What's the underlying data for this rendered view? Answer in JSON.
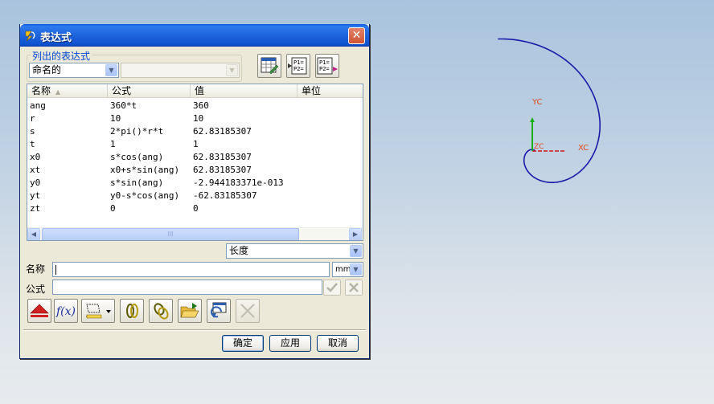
{
  "dialog": {
    "title": "表达式",
    "close_glyph": "✕",
    "listed_group_label": "列出的表达式",
    "filter_combo_value": "命名的",
    "secondary_combo_value": "",
    "tool_icons": [
      "spreadsheet-edit-icon",
      "import-expressions-icon",
      "export-expressions-icon"
    ],
    "columns": [
      "名称",
      "公式",
      "值",
      "单位"
    ],
    "rows": [
      {
        "name": "ang",
        "formula": "360*t",
        "value": "360",
        "unit": ""
      },
      {
        "name": "r",
        "formula": "10",
        "value": "10",
        "unit": ""
      },
      {
        "name": "s",
        "formula": "2*pi()*r*t",
        "value": "62.83185307",
        "unit": ""
      },
      {
        "name": "t",
        "formula": "1",
        "value": "1",
        "unit": ""
      },
      {
        "name": "x0",
        "formula": "s*cos(ang)",
        "value": "62.83185307",
        "unit": ""
      },
      {
        "name": "xt",
        "formula": "x0+s*sin(ang)",
        "value": "62.83185307",
        "unit": ""
      },
      {
        "name": "y0",
        "formula": "s*sin(ang)",
        "value": "-2.944183371e-013",
        "unit": ""
      },
      {
        "name": "yt",
        "formula": "y0-s*cos(ang)",
        "value": "-62.83185307",
        "unit": ""
      },
      {
        "name": "zt",
        "formula": "0",
        "value": "0",
        "unit": ""
      }
    ],
    "scroll_thumb_grip": "III",
    "type_combo_value": "长度",
    "name_label": "名称",
    "name_value": "",
    "unit_combo_value": "mm",
    "formula_label": "公式",
    "formula_value": "",
    "bottom_tool_icons": [
      "delete-icon",
      "function-icon",
      "measure-icon",
      "link-icon",
      "interpart-reference-icon",
      "open-file-icon",
      "refresh-icon",
      "cancel-edit-icon"
    ],
    "ok_label": "确定",
    "apply_label": "应用",
    "cancel_label": "取消"
  },
  "viewport": {
    "axis_x_label": "XC",
    "axis_y_label": "YC",
    "axis_z_label": "ZC",
    "curve_color": "#1a1aa8",
    "x_axis_color": "#d01818",
    "y_axis_color": "#18b018"
  }
}
